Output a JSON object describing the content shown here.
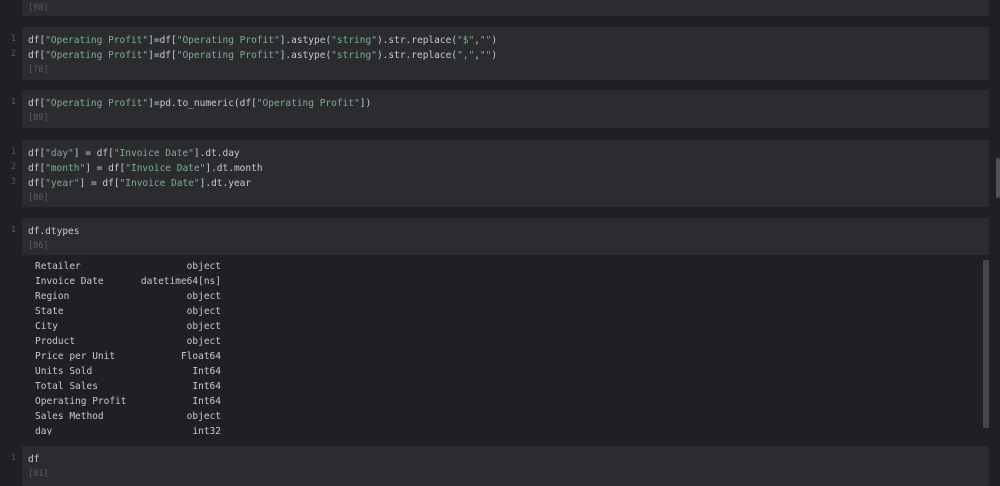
{
  "cells": [
    {
      "label": "[98]"
    },
    {
      "label": "[78]",
      "lines": [
        {
          "n": "1",
          "p": [
            "df[",
            "\"Operating Profit\"",
            "]=df[",
            "\"Operating Profit\"",
            "].astype(",
            "\"string\"",
            ").str.replace(",
            "\"$\"",
            ",",
            "\"\"",
            ")"
          ]
        },
        {
          "n": "2",
          "p": [
            "df[",
            "\"Operating Profit\"",
            "]=df[",
            "\"Operating Profit\"",
            "].astype(",
            "\"string\"",
            ").str.replace(",
            "\",\"",
            ",",
            "\"\"",
            ")"
          ]
        }
      ]
    },
    {
      "label": "[89]",
      "lines": [
        {
          "n": "1",
          "p": [
            "df[",
            "\"Operating Profit\"",
            "]=pd.to_numeric(df[",
            "\"Operating Profit\"",
            "])"
          ]
        }
      ]
    },
    {
      "label": "[80]",
      "lines": [
        {
          "n": "1",
          "p": [
            "df[",
            "\"day\"",
            "] = df[",
            "\"Invoice Date\"",
            "].dt.day"
          ]
        },
        {
          "n": "2",
          "p": [
            "df[",
            "\"month\"",
            "] = df[",
            "\"Invoice Date\"",
            "].dt.month"
          ]
        },
        {
          "n": "3",
          "p": [
            "df[",
            "\"year\"",
            "] = df[",
            "\"Invoice Date\"",
            "].dt.year"
          ]
        }
      ]
    },
    {
      "label": "[96]",
      "lines": [
        {
          "n": "1",
          "p": [
            "df.dtypes"
          ]
        }
      ]
    },
    {
      "label": "[81]",
      "lines": [
        {
          "n": "1",
          "p": [
            "df"
          ]
        }
      ]
    }
  ],
  "dtypes": [
    [
      "Retailer",
      "object"
    ],
    [
      "Invoice Date",
      "datetime64[ns]"
    ],
    [
      "Region",
      "object"
    ],
    [
      "State",
      "object"
    ],
    [
      "City",
      "object"
    ],
    [
      "Product",
      "object"
    ],
    [
      "Price per Unit",
      "Float64"
    ],
    [
      "Units Sold",
      "Int64"
    ],
    [
      "Total Sales",
      "Int64"
    ],
    [
      "Operating Profit",
      "Int64"
    ],
    [
      "Sales Method",
      "object"
    ],
    [
      "day",
      "int32"
    ]
  ]
}
